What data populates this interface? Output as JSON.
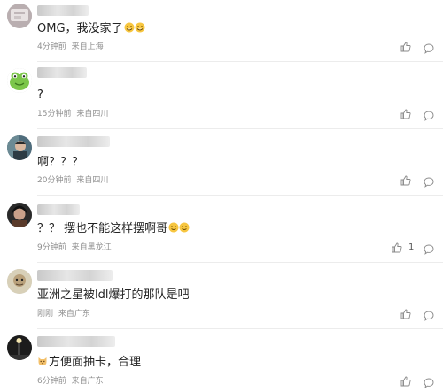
{
  "comments": [
    {
      "username": "",
      "text": "OMG，我没家了",
      "emoji_suffix": "crying-laughing",
      "time": "4分钟前",
      "location": "来自上海",
      "likes": ""
    },
    {
      "username": "",
      "text": "?",
      "emoji_suffix": "",
      "time": "15分钟前",
      "location": "来自四川",
      "likes": ""
    },
    {
      "username": "",
      "text": "啊？？？",
      "emoji_suffix": "",
      "time": "20分钟前",
      "location": "来自四川",
      "likes": ""
    },
    {
      "username": "",
      "text": "？？ 摆也不能这样摆啊哥",
      "emoji_suffix": "sweat-smile",
      "time": "9分钟前",
      "location": "来自黑龙江",
      "likes": "1"
    },
    {
      "username": "",
      "text": "亚洲之星被ldl爆打的那队是吧",
      "emoji_suffix": "",
      "time": "刚刚",
      "location": "来自广东",
      "likes": ""
    },
    {
      "username": "",
      "text": "方便面抽卡，合理",
      "emoji_prefix": "cat-face",
      "time": "6分钟前",
      "location": "来自广东",
      "likes": ""
    }
  ],
  "colors": {
    "text": "#222222",
    "meta": "#8f8f8f",
    "icon": "#888888"
  },
  "icons": {
    "like": "thumbs-up-icon",
    "reply": "comment-bubble-icon"
  }
}
